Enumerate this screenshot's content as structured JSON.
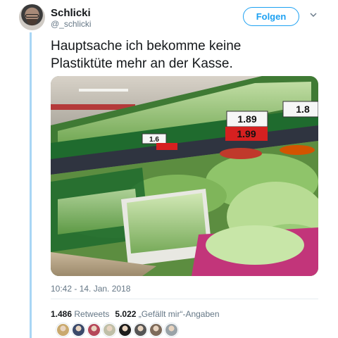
{
  "user": {
    "name": "Schlicki",
    "handle": "@_schlicki",
    "avatar_icon": "profile-photo"
  },
  "follow": {
    "label": "Folgen",
    "color": "#1da1f2"
  },
  "menu": {
    "icon": "chevron-down-icon"
  },
  "tweet": {
    "text_line1": "Hauptsache ich bekomme keine",
    "text_line2": "Plastiktüte mehr an der Kasse.",
    "photo": {
      "description_icon": "supermarket-produce-photo",
      "price_tag_top": "1.89",
      "price_tag_red": "1.99",
      "price_tag_right": "1.8",
      "price_tag_mid": "1.6"
    },
    "timestamp": "10:42 - 14. Jan. 2018"
  },
  "stats": {
    "retweets_count": "1.486",
    "retweets_label": "Retweets",
    "likes_count": "5.022",
    "likes_label": "„Gefällt mir“-Angaben"
  },
  "likers": [
    {
      "name": "liker-avatar-1",
      "color": "#c9a96e"
    },
    {
      "name": "liker-avatar-2",
      "color": "#3b4a6b"
    },
    {
      "name": "liker-avatar-3",
      "color": "#b5475a"
    },
    {
      "name": "liker-avatar-4",
      "color": "#bfbfa8"
    },
    {
      "name": "liker-avatar-5",
      "color": "#1c1c1c"
    },
    {
      "name": "liker-avatar-6",
      "color": "#555555"
    },
    {
      "name": "liker-avatar-7",
      "color": "#7d6a5a"
    },
    {
      "name": "liker-avatar-8",
      "color": "#9aa3a8"
    }
  ]
}
